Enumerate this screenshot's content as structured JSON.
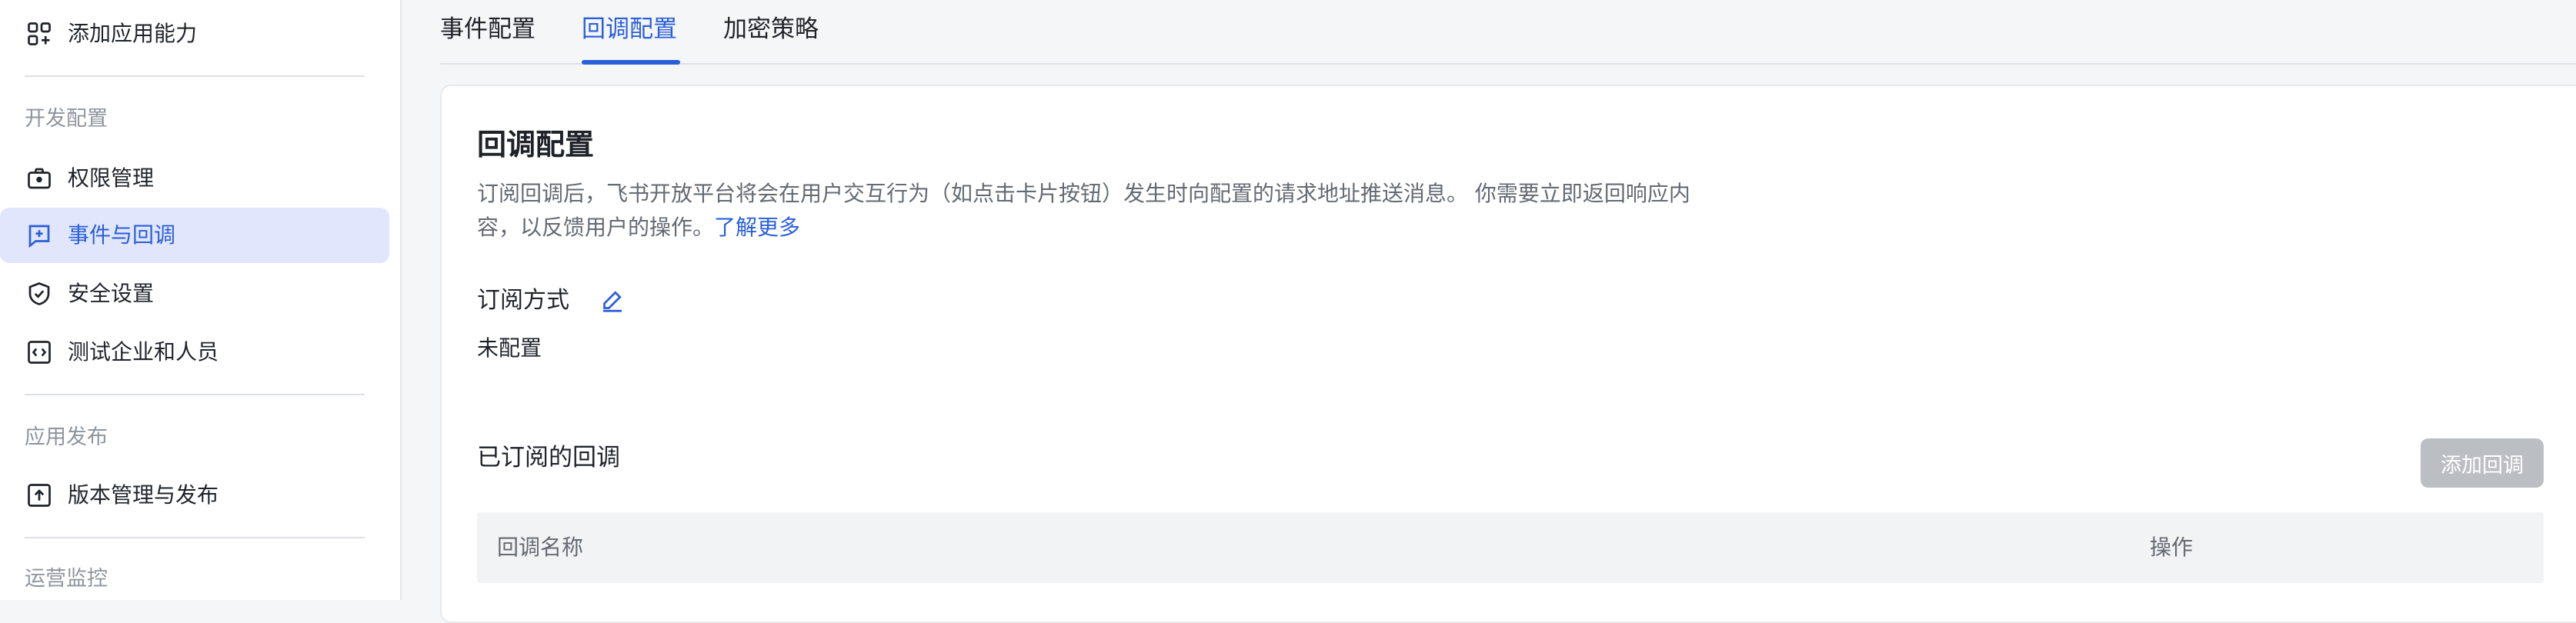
{
  "sidebar": {
    "add_capability": {
      "label": "添加应用能力",
      "icon": "grid-plus-icon"
    },
    "sections": [
      {
        "title": "开发配置"
      },
      {
        "title": "应用发布"
      },
      {
        "title": "运营监控"
      }
    ],
    "items": [
      {
        "label": "权限管理",
        "icon": "briefcase-lock-icon"
      },
      {
        "label": "事件与回调",
        "icon": "message-plus-icon",
        "active": true
      },
      {
        "label": "安全设置",
        "icon": "shield-check-icon"
      },
      {
        "label": "测试企业和人员",
        "icon": "code-box-icon"
      },
      {
        "label": "版本管理与发布",
        "icon": "upload-box-icon"
      }
    ]
  },
  "tabs": [
    {
      "label": "事件配置"
    },
    {
      "label": "回调配置",
      "active": true
    },
    {
      "label": "加密策略"
    }
  ],
  "main": {
    "title": "回调配置",
    "description": "订阅回调后，飞书开放平台将会在用户交互行为（如点击卡片按钮）发生时向配置的请求地址推送消息。 你需要立即返回响应内容，以反馈用户的操作。",
    "learn_more": "了解更多",
    "subscription": {
      "title": "订阅方式",
      "status": "未配置"
    },
    "subscribed": {
      "title": "已订阅的回调",
      "add_button": "添加回调",
      "columns": [
        "回调名称",
        "操作"
      ]
    }
  },
  "colors": {
    "accent": "#2a5fd9",
    "active_bg": "#e1e6fc",
    "disabled_button": "#bbbfc4"
  }
}
